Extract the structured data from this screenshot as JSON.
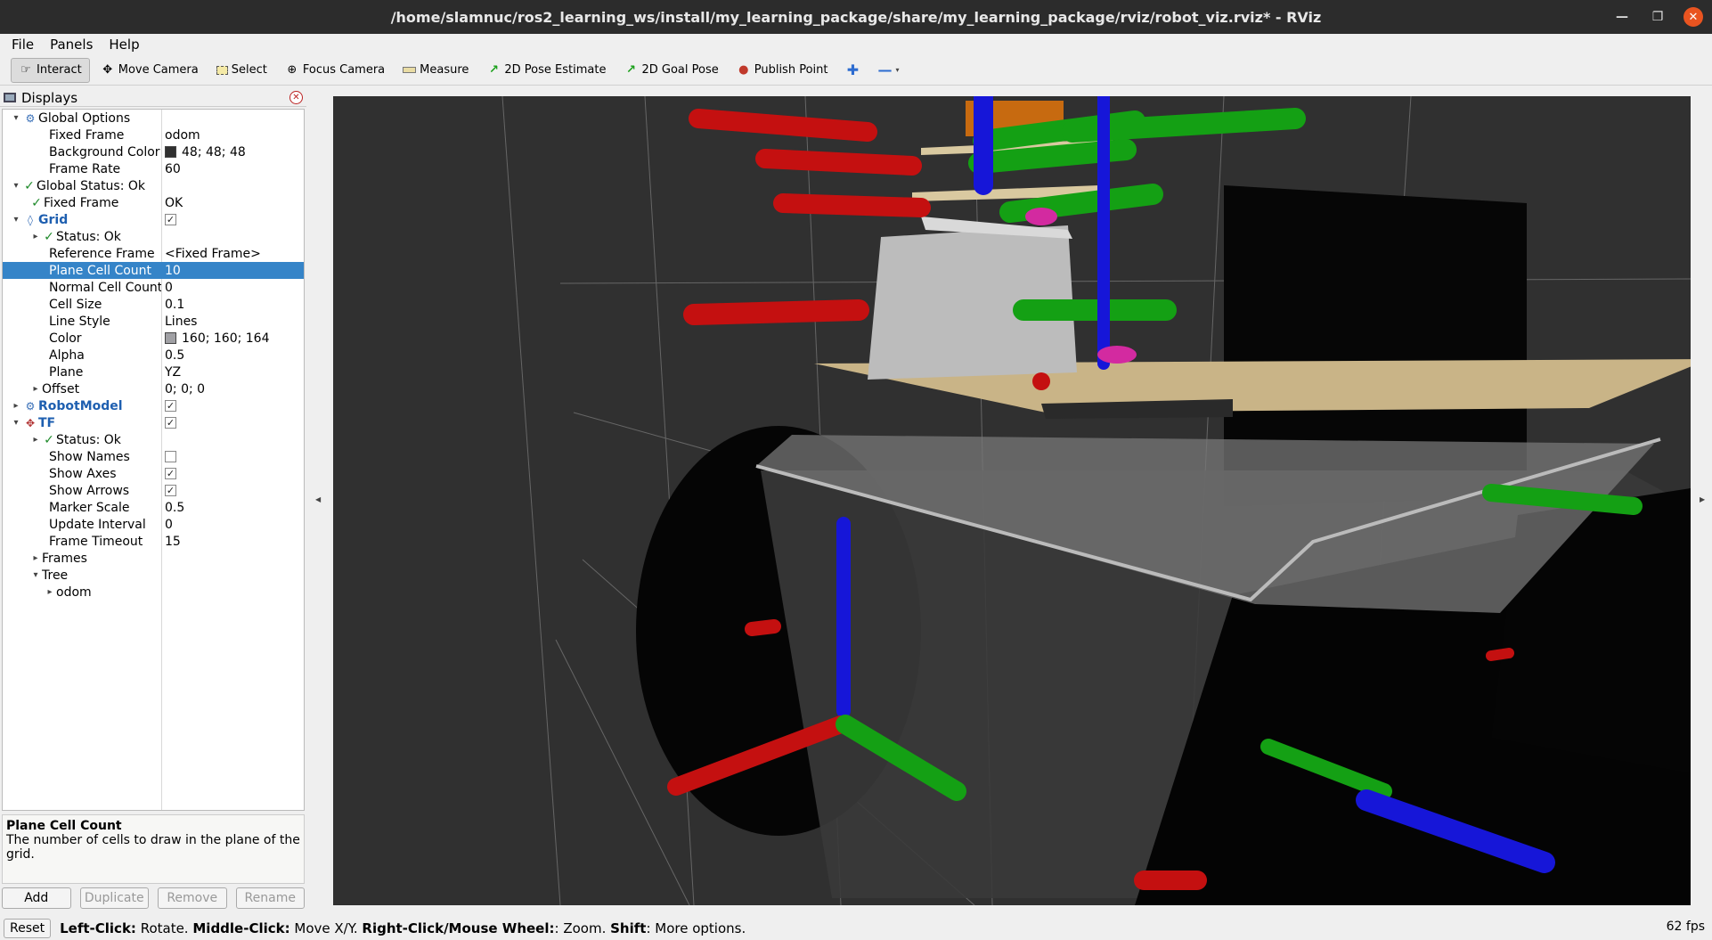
{
  "window": {
    "title": "/home/slamnuc/ros2_learning_ws/install/my_learning_package/share/my_learning_package/rviz/robot_viz.rviz* - RViz"
  },
  "menu": [
    "File",
    "Panels",
    "Help"
  ],
  "toolbar": {
    "interact": "Interact",
    "move_camera": "Move Camera",
    "select": "Select",
    "focus_camera": "Focus Camera",
    "measure": "Measure",
    "pose_estimate": "2D Pose Estimate",
    "goal_pose": "2D Goal Pose",
    "publish_point": "Publish Point"
  },
  "displays": {
    "title": "Displays",
    "rows": {
      "global_options": "Global Options",
      "fixed_frame": "Fixed Frame",
      "fixed_frame_val": "odom",
      "bg_color": "Background Color",
      "bg_color_val": "48; 48; 48",
      "frame_rate": "Frame Rate",
      "frame_rate_val": "60",
      "global_status": "Global Status: Ok",
      "fixed_frame_status": "Fixed Frame",
      "fixed_frame_status_val": "OK",
      "grid": "Grid",
      "grid_status": "Status: Ok",
      "reference_frame": "Reference Frame",
      "reference_frame_val": "<Fixed Frame>",
      "plane_cell_count": "Plane Cell Count",
      "plane_cell_count_val": "10",
      "normal_cell_count": "Normal Cell Count",
      "normal_cell_count_val": "0",
      "cell_size": "Cell Size",
      "cell_size_val": "0.1",
      "line_style": "Line Style",
      "line_style_val": "Lines",
      "color": "Color",
      "color_val": "160; 160; 164",
      "alpha": "Alpha",
      "alpha_val": "0.5",
      "plane": "Plane",
      "plane_val": "YZ",
      "offset": "Offset",
      "offset_val": "0; 0; 0",
      "robot_model": "RobotModel",
      "tf": "TF",
      "tf_status": "Status: Ok",
      "show_names": "Show Names",
      "show_axes": "Show Axes",
      "show_arrows": "Show Arrows",
      "marker_scale": "Marker Scale",
      "marker_scale_val": "0.5",
      "update_interval": "Update Interval",
      "update_interval_val": "0",
      "frame_timeout": "Frame Timeout",
      "frame_timeout_val": "15",
      "frames": "Frames",
      "tree": "Tree",
      "odom": "odom"
    },
    "colors": {
      "bg_swatch": "#303030",
      "grid_swatch": "#a0a0a4"
    }
  },
  "help": {
    "title": "Plane Cell Count",
    "text": "The number of cells to draw in the plane of the grid."
  },
  "buttons": {
    "add": "Add",
    "duplicate": "Duplicate",
    "remove": "Remove",
    "rename": "Rename"
  },
  "status": {
    "reset": "Reset",
    "left_click": "Left-Click:",
    "left_click_desc": "Rotate.",
    "middle_click": "Middle-Click:",
    "middle_click_desc": "Move X/Y.",
    "right_click": "Right-Click/Mouse Wheel:",
    "right_click_desc": ": Zoom.",
    "shift": "Shift",
    "shift_desc": ": More options.",
    "fps": "62 fps"
  }
}
